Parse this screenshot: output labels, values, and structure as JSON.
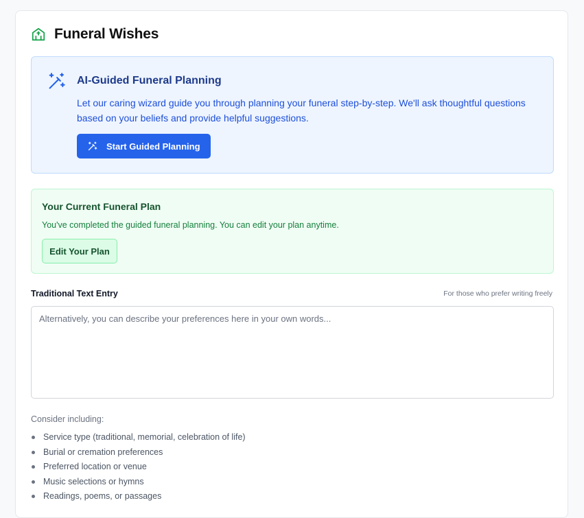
{
  "page": {
    "title": "Funeral Wishes",
    "title_icon": "home-heart-icon"
  },
  "ai_panel": {
    "icon": "magic-wand-icon",
    "heading": "AI-Guided Funeral Planning",
    "description": "Let our caring wizard guide you through planning your funeral step-by-step. We'll ask thoughtful questions based on your beliefs and provide helpful suggestions.",
    "button_icon": "magic-wand-icon",
    "button_label": "Start Guided Planning"
  },
  "plan_panel": {
    "heading": "Your Current Funeral Plan",
    "description": "You've completed the guided funeral planning. You can edit your plan anytime.",
    "button_label": "Edit Your Plan"
  },
  "text_entry": {
    "label": "Traditional Text Entry",
    "hint": "For those who prefer writing freely",
    "value": "",
    "placeholder": "Alternatively, you can describe your preferences here in your own words..."
  },
  "suggestions": {
    "heading": "Consider including:",
    "items": [
      "Service type (traditional, memorial, celebration of life)",
      "Burial or cremation preferences",
      "Preferred location or venue",
      "Music selections or hymns",
      "Readings, poems, or passages"
    ]
  },
  "colors": {
    "accent": "#2563eb",
    "title_icon": "#16a34a",
    "info_bg": "#eef5ff",
    "success_bg": "#f0fdf4"
  }
}
